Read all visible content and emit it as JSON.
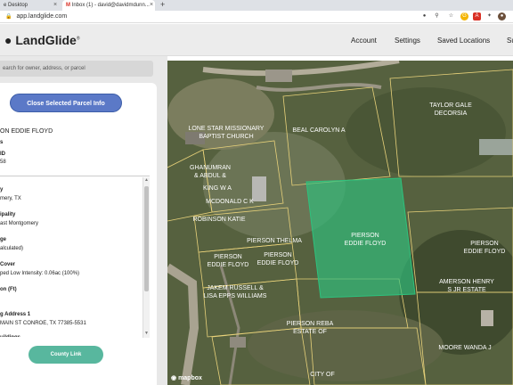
{
  "browser": {
    "tabs": [
      {
        "title": "e Desktop"
      },
      {
        "title": "Inbox (1) - david@davidmdunn..."
      }
    ],
    "new_tab_symbol": "+",
    "close_symbol": "×",
    "url": "app.landglide.com"
  },
  "app": {
    "logo": "LandGlide",
    "logo_mark": "®",
    "nav": [
      "Account",
      "Settings",
      "Saved Locations",
      "Su"
    ]
  },
  "search": {
    "placeholder": "earch for owner, address, or parcel"
  },
  "panel": {
    "close_button": "Close Selected Parcel Info",
    "owner": "ON EDDIE FLOYD",
    "header_fields": [
      {
        "label": "s",
        "value": ""
      },
      {
        "label": "ID",
        "value": "58"
      }
    ],
    "details": [
      {
        "label": "y",
        "value": "mery, TX"
      },
      {
        "label": "ipality",
        "value": "ast Montgomery"
      },
      {
        "label": "ge",
        "value": "alculated)"
      },
      {
        "label": "Cover",
        "value": "ped Low Intensity: 0.06ac (100%)"
      },
      {
        "label": "on (Ft)",
        "value": ""
      },
      {
        "label": "g Address 1",
        "value": "MAIN ST CONROE, TX 77385-5531"
      },
      {
        "label": "uildings",
        "value": ""
      }
    ],
    "county_button": "County Link"
  },
  "map": {
    "labels": [
      {
        "text": "LONE STAR MISSIONARY",
        "sub": "BAPTIST CHURCH"
      },
      {
        "text": "BEAL CAROLYN A",
        "sub": ""
      },
      {
        "text": "TAYLOR GALE",
        "sub": "DECORSIA"
      },
      {
        "text": "GHANUMRAN",
        "sub": "& ABDUL &"
      },
      {
        "text": "KING W A",
        "sub": ""
      },
      {
        "text": "MCDONALD C K",
        "sub": ""
      },
      {
        "text": "ROBINSON KATIE",
        "sub": ""
      },
      {
        "text": "PIERSON THELMA",
        "sub": ""
      },
      {
        "text": "PIERSON",
        "sub": "EDDIE FLOYD"
      },
      {
        "text": "PIERSON",
        "sub": "EDDIE FLOYD"
      },
      {
        "text": "PIERSON",
        "sub": "EDDIE FLOYD"
      },
      {
        "text": "PIERSON",
        "sub": "EDDIE FLOYD"
      },
      {
        "text": "JAKEM RUSSELL &",
        "sub": "LISA EPPS WILLIAMS"
      },
      {
        "text": "AMERSON HENRY",
        "sub": "S JR ESTATE"
      },
      {
        "text": "PIERSON REBA",
        "sub": "ESTATE OF"
      },
      {
        "text": "MOORE WANDA J",
        "sub": ""
      },
      {
        "text": "CITY OF",
        "sub": ""
      }
    ],
    "attribution": "mapbox",
    "colors": {
      "selected_parcel": "#2ec27e",
      "parcel_lines": "#e8d27a"
    }
  }
}
